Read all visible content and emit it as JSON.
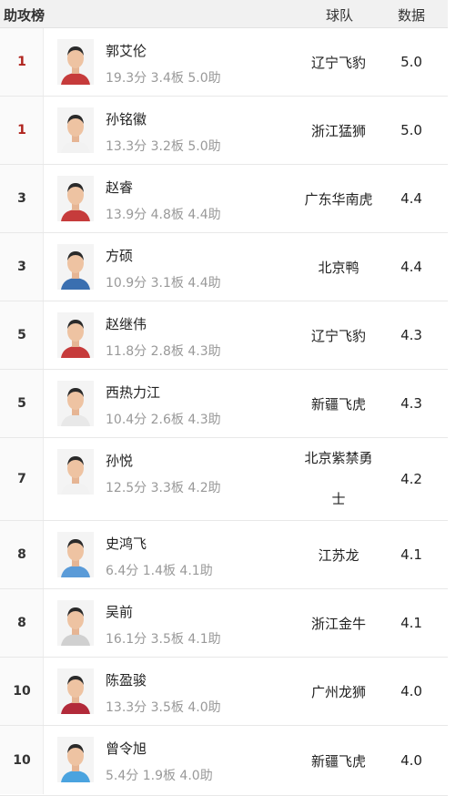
{
  "header": {
    "title": "助攻榜",
    "team_col": "球队",
    "data_col": "数据"
  },
  "players": [
    {
      "rank": "1",
      "name": "郭艾伦",
      "stats": "19.3分  3.4板  5.0助",
      "team": "辽宁飞豹",
      "value": "5.0"
    },
    {
      "rank": "1",
      "name": "孙铭徽",
      "stats": "13.3分  3.2板  5.0助",
      "team": "浙江猛狮",
      "value": "5.0"
    },
    {
      "rank": "3",
      "name": "赵睿",
      "stats": "13.9分  4.8板  4.4助",
      "team": "广东华南虎",
      "value": "4.4"
    },
    {
      "rank": "3",
      "name": "方硕",
      "stats": "10.9分  3.1板  4.4助",
      "team": "北京鸭",
      "value": "4.4"
    },
    {
      "rank": "5",
      "name": "赵继伟",
      "stats": "11.8分  2.8板  4.3助",
      "team": "辽宁飞豹",
      "value": "4.3"
    },
    {
      "rank": "5",
      "name": "西热力江",
      "stats": "10.4分  2.6板  4.3助",
      "team": "新疆飞虎",
      "value": "4.3"
    },
    {
      "rank": "7",
      "name": "孙悦",
      "stats": "12.5分  3.3板  4.2助",
      "team": "北京紫禁勇士",
      "value": "4.2"
    },
    {
      "rank": "8",
      "name": "史鸿飞",
      "stats": "6.4分  1.4板  4.1助",
      "team": "江苏龙",
      "value": "4.1"
    },
    {
      "rank": "8",
      "name": "吴前",
      "stats": "16.1分  3.5板  4.1助",
      "team": "浙江金牛",
      "value": "4.1"
    },
    {
      "rank": "10",
      "name": "陈盈骏",
      "stats": "13.3分  3.5板  4.0助",
      "team": "广州龙狮",
      "value": "4.0"
    },
    {
      "rank": "10",
      "name": "曾令旭",
      "stats": "5.4分  1.9板  4.0助",
      "team": "新疆飞虎",
      "value": "4.0"
    }
  ],
  "colors": {
    "top_rank": "#b0241e",
    "stats_text": "#999999",
    "header_bg": "#f1f1f1"
  }
}
